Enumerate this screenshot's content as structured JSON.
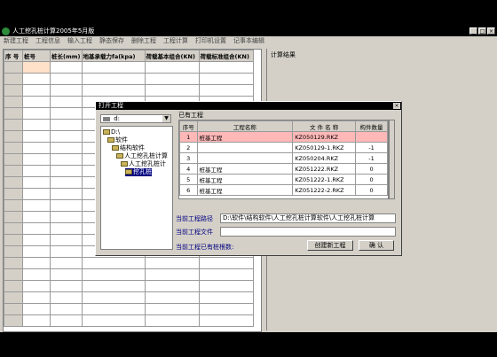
{
  "app": {
    "title": "人工挖孔桩计算2005年5月版",
    "controls": [
      "_",
      "□",
      "×"
    ]
  },
  "menu": [
    "新建工程",
    "工程信息",
    "输入工程",
    "静态保存",
    "删除工程",
    "工程计算",
    "打印机设置",
    "记事本编辑"
  ],
  "grid": {
    "headers": [
      "序 号",
      "桩号",
      "桩长(mm)",
      "地基承载力fa(kpa)",
      "荷载基本组合(KN)",
      "荷载标准组合(KN)"
    ],
    "row_count": 23
  },
  "right_panel": {
    "label": "计算结果"
  },
  "dialog": {
    "title": "打开工程",
    "close": "×",
    "drive": "d:",
    "tree": [
      {
        "label": "D:\\",
        "level": 0
      },
      {
        "label": "软件",
        "level": 1
      },
      {
        "label": "结构软件",
        "level": 2
      },
      {
        "label": "人工挖孔桩计算",
        "level": 3
      },
      {
        "label": "人工挖孔桩计",
        "level": 4
      },
      {
        "label": "挖孔桩",
        "level": 5,
        "selected": true
      }
    ],
    "existing_label": "已有工程",
    "table": {
      "headers": [
        "序号",
        "工程名称",
        "文 件 名 称",
        "构件数量"
      ],
      "rows": [
        {
          "no": "1",
          "name": "桩基工程",
          "file": "KZ050129.RKZ",
          "count": "",
          "selected": true
        },
        {
          "no": "2",
          "name": "",
          "file": "KZ050129-1.RKZ",
          "count": "-1"
        },
        {
          "no": "3",
          "name": "",
          "file": "KZ050204.RKZ",
          "count": "-1"
        },
        {
          "no": "4",
          "name": "桩基工程",
          "file": "KZ051222.RKZ",
          "count": "0"
        },
        {
          "no": "5",
          "name": "桩基工程",
          "file": "KZ051222-1.RKZ",
          "count": "0"
        },
        {
          "no": "6",
          "name": "桩基工程",
          "file": "KZ051222-2.RKZ",
          "count": "0"
        }
      ]
    },
    "path_label": "当前工程路径",
    "path_value": "D:\\软件\\结构软件\\人工挖孔桩计算软件\\人工挖孔桩计算",
    "file_label": "当前工程文件",
    "file_value": "",
    "count_label": "当前工程已有桩根数:",
    "new_button": "创建新工程",
    "ok_button": "确 认"
  }
}
